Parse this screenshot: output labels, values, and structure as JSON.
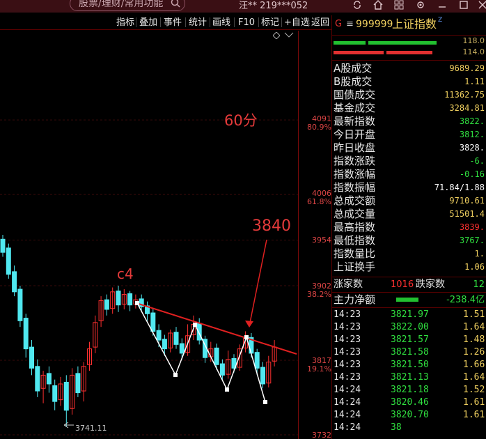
{
  "topbar": {
    "search_placeholder": "股票/理财/常用功能",
    "user": "汪** 219***052"
  },
  "toolbar": {
    "buttons": [
      "指标",
      "叠加",
      "事件",
      "统计",
      "画线",
      "F10",
      "标记",
      "+自选",
      "返回"
    ]
  },
  "chart": {
    "axis_labels": [
      {
        "price": "4091",
        "pct": "80.9%"
      },
      {
        "price": "4006",
        "pct": "61.8%"
      },
      {
        "price": "3954",
        "pct": ""
      },
      {
        "price": "3902",
        "pct": "38.2%"
      },
      {
        "price": "3817",
        "pct": "19.1%"
      },
      {
        "price": "3732",
        "pct": ""
      }
    ],
    "annotation_period": "60分",
    "annotation_c4": "c4",
    "annotation_3840": "3840",
    "low_label": "3741.11",
    "colors": {
      "up": "#ff3030",
      "down": "#50e8f0",
      "trend": "#e02020",
      "zigzag": "#ffffff"
    }
  },
  "panel": {
    "code": "999999",
    "name": "上证指数",
    "bar_top_value": "118.0",
    "bar_bottom_value": "114.0",
    "stats": [
      {
        "label": "A股成交",
        "value": "9689.29",
        "color": "#f0d060"
      },
      {
        "label": "B股成交",
        "value": "1.11",
        "color": "#f0d060"
      },
      {
        "label": "国债成交",
        "value": "11362.75",
        "color": "#f0d060"
      },
      {
        "label": "基金成交",
        "value": "3284.81",
        "color": "#f0d060"
      },
      {
        "label": "最新指数",
        "value": "3822.",
        "color": "#30e040"
      },
      {
        "label": "今日开盘",
        "value": "3812.",
        "color": "#30e040"
      },
      {
        "label": "昨日收盘",
        "value": "3828.",
        "color": "#ffffff"
      },
      {
        "label": "指数涨跌",
        "value": "-6.",
        "color": "#30e040"
      },
      {
        "label": "指数涨幅",
        "value": "-0.16",
        "color": "#30e040"
      },
      {
        "label": "指数振幅",
        "value": "71.84/1.88",
        "color": "#ffffff"
      },
      {
        "label": "总成交额",
        "value": "9710.61",
        "color": "#f0d060"
      },
      {
        "label": "总成交量",
        "value": "51501.4",
        "color": "#f0d060"
      },
      {
        "label": "最高指数",
        "value": "3839.",
        "color": "#ff3030"
      },
      {
        "label": "最低指数",
        "value": "3767.",
        "color": "#30e040"
      },
      {
        "label": "指数量比",
        "value": "1.",
        "color": "#f0d060"
      },
      {
        "label": "上证换手",
        "value": "1.06",
        "color": "#f0d060"
      }
    ],
    "breadth": {
      "up_label": "涨家数",
      "up_value": "1016",
      "down_label": "跌家数",
      "down_value": "12"
    },
    "main_flow": {
      "label": "主力净额",
      "value": "-238.4亿"
    },
    "trades": [
      {
        "time": "14:23",
        "price": "3821.97",
        "vol": "1.51"
      },
      {
        "time": "14:23",
        "price": "3822.00",
        "vol": "1.64"
      },
      {
        "time": "14:23",
        "price": "3821.57",
        "vol": "1.48"
      },
      {
        "time": "14:23",
        "price": "3821.58",
        "vol": "1.26"
      },
      {
        "time": "14:23",
        "price": "3821.50",
        "vol": "1.66"
      },
      {
        "time": "14:23",
        "price": "3821.13",
        "vol": "1.64"
      },
      {
        "time": "14:24",
        "price": "3821.18",
        "vol": "1.52"
      },
      {
        "time": "14:24",
        "price": "3820.46",
        "vol": "1.61"
      },
      {
        "time": "14:24",
        "price": "3820.70",
        "vol": "1.61"
      },
      {
        "time": "14:24",
        "price": "38",
        "vol": ""
      }
    ]
  }
}
